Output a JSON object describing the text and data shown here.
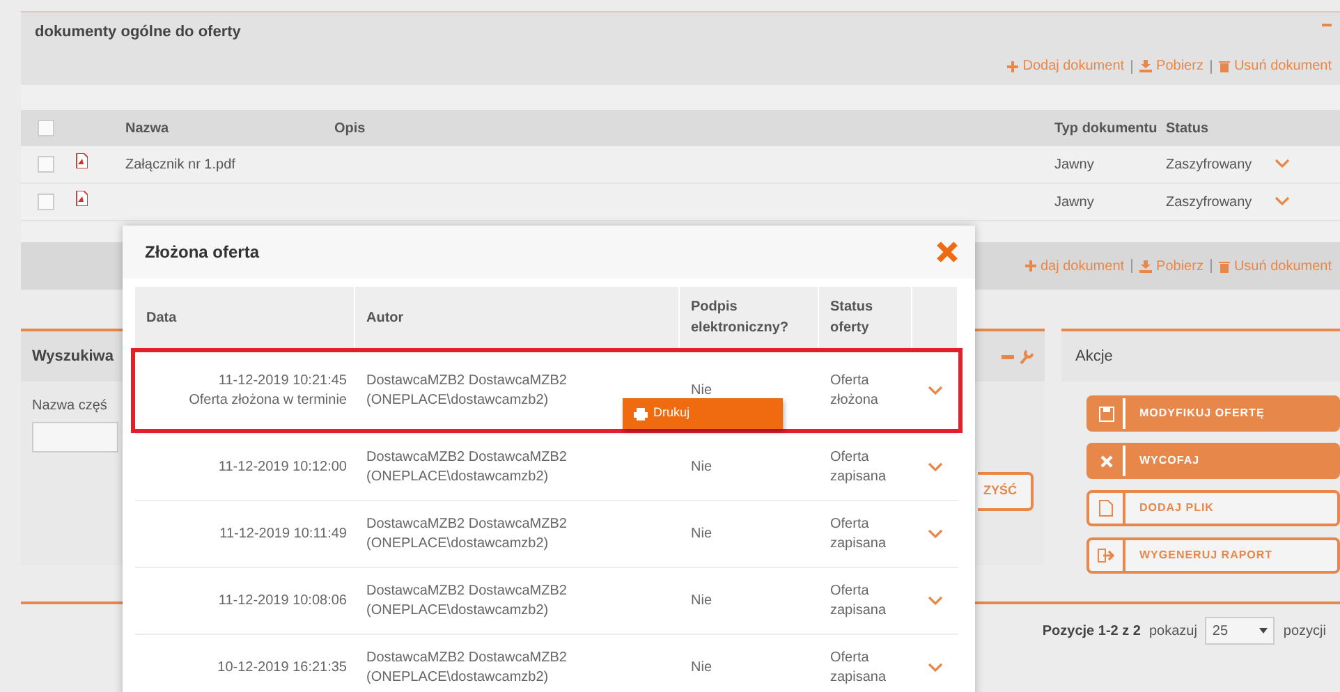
{
  "documents_panel": {
    "title": "dokumenty ogólne do oferty",
    "actions": [
      "Dodaj dokument",
      "Pobierz",
      "Usuń dokument"
    ],
    "header_checked": false,
    "columns": [
      "Nazwa",
      "Opis",
      "Typ dokumentu",
      "Status"
    ],
    "rows": [
      {
        "checked": false,
        "name": "Załącznik nr 1.pdf",
        "type": "Jawny",
        "status": "Zaszyfrowany"
      },
      {
        "checked": false,
        "type": "Jawny",
        "status": "Zaszyfrowany"
      }
    ],
    "footer_actions": [
      "daj dokument",
      "Pobierz",
      "Usuń dokument"
    ]
  },
  "search_panel": {
    "title": "Wyszukiwa",
    "field_label": "Nazwa częś",
    "clear_button": "ZYŚĆ"
  },
  "actions_panel": {
    "title": "Akcje",
    "buttons": [
      {
        "label": "MODYFIKUJ OFERTĘ",
        "kind": "filled"
      },
      {
        "label": "WYCOFAJ",
        "kind": "filled"
      },
      {
        "label": "DODAJ PLIK",
        "kind": "outline"
      },
      {
        "label": "WYGENERUJ RAPORT",
        "kind": "outline"
      }
    ]
  },
  "pagination": {
    "summary": "Pozycje 1-2 z 2",
    "show_label": "pokazuj",
    "page_size": "25",
    "suffix": "pozycji"
  },
  "modal": {
    "title": "Złożona oferta",
    "columns": [
      "Data",
      "Autor",
      "Podpis elektroniczny?",
      "Status oferty"
    ],
    "rows": [
      {
        "date": "11-12-2019 10:21:45",
        "note": "Oferta złożona w terminie",
        "author": "DostawcaMZB2 DostawcaMZB2",
        "login": "(ONEPLACE\\dostawcamzb2)",
        "signature": "Nie",
        "status": "Oferta złożona",
        "highlighted": true
      },
      {
        "date": "11-12-2019 10:12:00",
        "author": "DostawcaMZB2 DostawcaMZB2",
        "login": "(ONEPLACE\\dostawcamzb2)",
        "signature": "Nie",
        "status": "Oferta zapisana",
        "highlighted": false
      },
      {
        "date": "11-12-2019 10:11:49",
        "author": "DostawcaMZB2 DostawcaMZB2",
        "login": "(ONEPLACE\\dostawcamzb2)",
        "signature": "Nie",
        "status": "Oferta zapisana",
        "highlighted": false
      },
      {
        "date": "11-12-2019 10:08:06",
        "author": "DostawcaMZB2 DostawcaMZB2",
        "login": "(ONEPLACE\\dostawcamzb2)",
        "signature": "Nie",
        "status": "Oferta zapisana",
        "highlighted": false
      },
      {
        "date": "10-12-2019 16:21:35",
        "author": "DostawcaMZB2 DostawcaMZB2",
        "login": "(ONEPLACE\\dostawcamzb2)",
        "signature": "Nie",
        "status": "Oferta zapisana",
        "highlighted": false
      }
    ],
    "menu": {
      "label": "Drukuj"
    }
  }
}
